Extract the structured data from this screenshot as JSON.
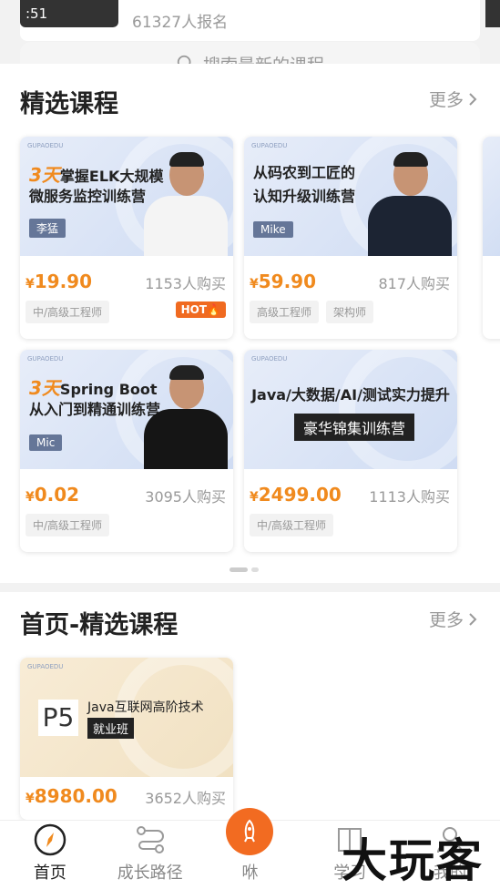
{
  "top": {
    "thumb_text": ":51",
    "enroll_text": "61327人报名"
  },
  "search": {
    "placeholder": "搜索最新的课程"
  },
  "section1": {
    "title": "精选课程",
    "more": "更多",
    "cards": [
      {
        "brand": "GUPAOEDU",
        "accent": "3天",
        "line1_rest": "掌握ELK大规模",
        "line2": "微服务监控训练营",
        "teacher": "李猛",
        "price_symbol": "¥",
        "price": "19.90",
        "buyers": "1153人购买",
        "tags": [
          "中/高级工程师"
        ],
        "badge": "HOT🔥",
        "shirt": "#ffffff"
      },
      {
        "brand": "GUPAOEDU",
        "accent": "",
        "line1_rest": "从码农到工匠的",
        "line2": "认知升级训练营",
        "teacher": "Mike",
        "price_symbol": "¥",
        "price": "59.90",
        "buyers": "817人购买",
        "tags": [
          "高级工程师",
          "架构师"
        ],
        "badge": "",
        "shirt": "#1c2433"
      },
      {
        "brand": "GUPAOEDU",
        "accent": "3天",
        "line1_rest": "Spring Boot",
        "line2": "从入门到精通训练营",
        "teacher": "Mic",
        "price_symbol": "¥",
        "price": "0.02",
        "buyers": "3095人购买",
        "tags": [
          "中/高级工程师"
        ],
        "badge": "",
        "shirt": "#151515"
      },
      {
        "brand": "GUPAOEDU",
        "accent": "",
        "line1_rest": "Java/大数据/AI/测试实力提升",
        "line2": "豪华锦集训练营",
        "teacher": "",
        "price_symbol": "¥",
        "price": "2499.00",
        "buyers": "1113人购买",
        "tags": [
          "中/高级工程师"
        ],
        "badge": ""
      }
    ]
  },
  "section2": {
    "title": "首页-精选课程",
    "more": "更多",
    "cards": [
      {
        "brand": "GUPAOEDU",
        "level": "P5",
        "line1": "Java互联网高阶技术",
        "line2": "就业班",
        "price_symbol": "¥",
        "price": "8980.00",
        "buyers": "3652人购买"
      }
    ]
  },
  "nav": {
    "items": [
      {
        "label": "首页",
        "icon": "compass-icon",
        "active": true
      },
      {
        "label": "成长路径",
        "icon": "path-icon"
      },
      {
        "label": "咻",
        "icon": "rocket-icon"
      },
      {
        "label": "学习",
        "icon": "book-icon"
      },
      {
        "label": "我的",
        "icon": "user-icon"
      }
    ]
  },
  "watermark": "大玩客",
  "colors": {
    "accent": "#f08a1e",
    "nav_center": "#f26b21"
  }
}
